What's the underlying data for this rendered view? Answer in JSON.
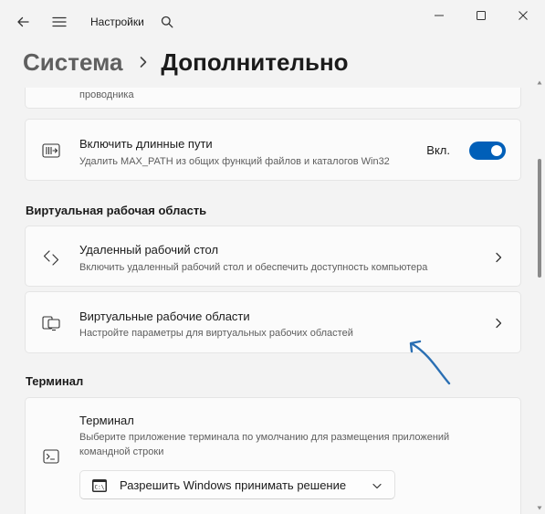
{
  "window": {
    "title": "Настройки",
    "back_icon": "back-arrow-icon",
    "menu_icon": "hamburger-menu-icon",
    "search_icon": "search-icon",
    "minimize_icon": "minimize-icon",
    "maximize_icon": "maximize-icon",
    "close_icon": "close-icon"
  },
  "breadcrumb": {
    "parent": "Система",
    "separator_icon": "chevron-right-icon",
    "current": "Дополнительно"
  },
  "partial_card": {
    "desc_tail": "проводника"
  },
  "long_paths": {
    "title": "Включить длинные пути",
    "desc": "Удалить MAX_PATH из общих функций файлов и каталогов Win32",
    "toggle_label": "Вкл.",
    "toggle_on": true,
    "icon": "long-paths-icon"
  },
  "sections": {
    "virtual_workspaces": "Виртуальная рабочая область",
    "terminal": "Терминал"
  },
  "remote_desktop": {
    "title": "Удаленный рабочий стол",
    "desc": "Включить удаленный рабочий стол и обеспечить доступность компьютера",
    "icon": "remote-desktop-icon"
  },
  "virtual_workspaces_card": {
    "title": "Виртуальные рабочие области",
    "desc": "Настройте параметры для виртуальных рабочих областей",
    "icon": "virtual-workspaces-icon"
  },
  "terminal_card": {
    "title": "Терминал",
    "desc_line1": "Выберите приложение терминала по умолчанию для размещения приложений",
    "desc_line2": "командной строки",
    "icon": "terminal-icon",
    "dropdown_value": "Разрешить Windows принимать решение",
    "dropdown_icon": "command-prompt-icon"
  },
  "colors": {
    "accent": "#005fb8",
    "background": "#f3f3f3",
    "card": "#fbfbfb",
    "annotation_arrow": "#2a6fb3"
  }
}
